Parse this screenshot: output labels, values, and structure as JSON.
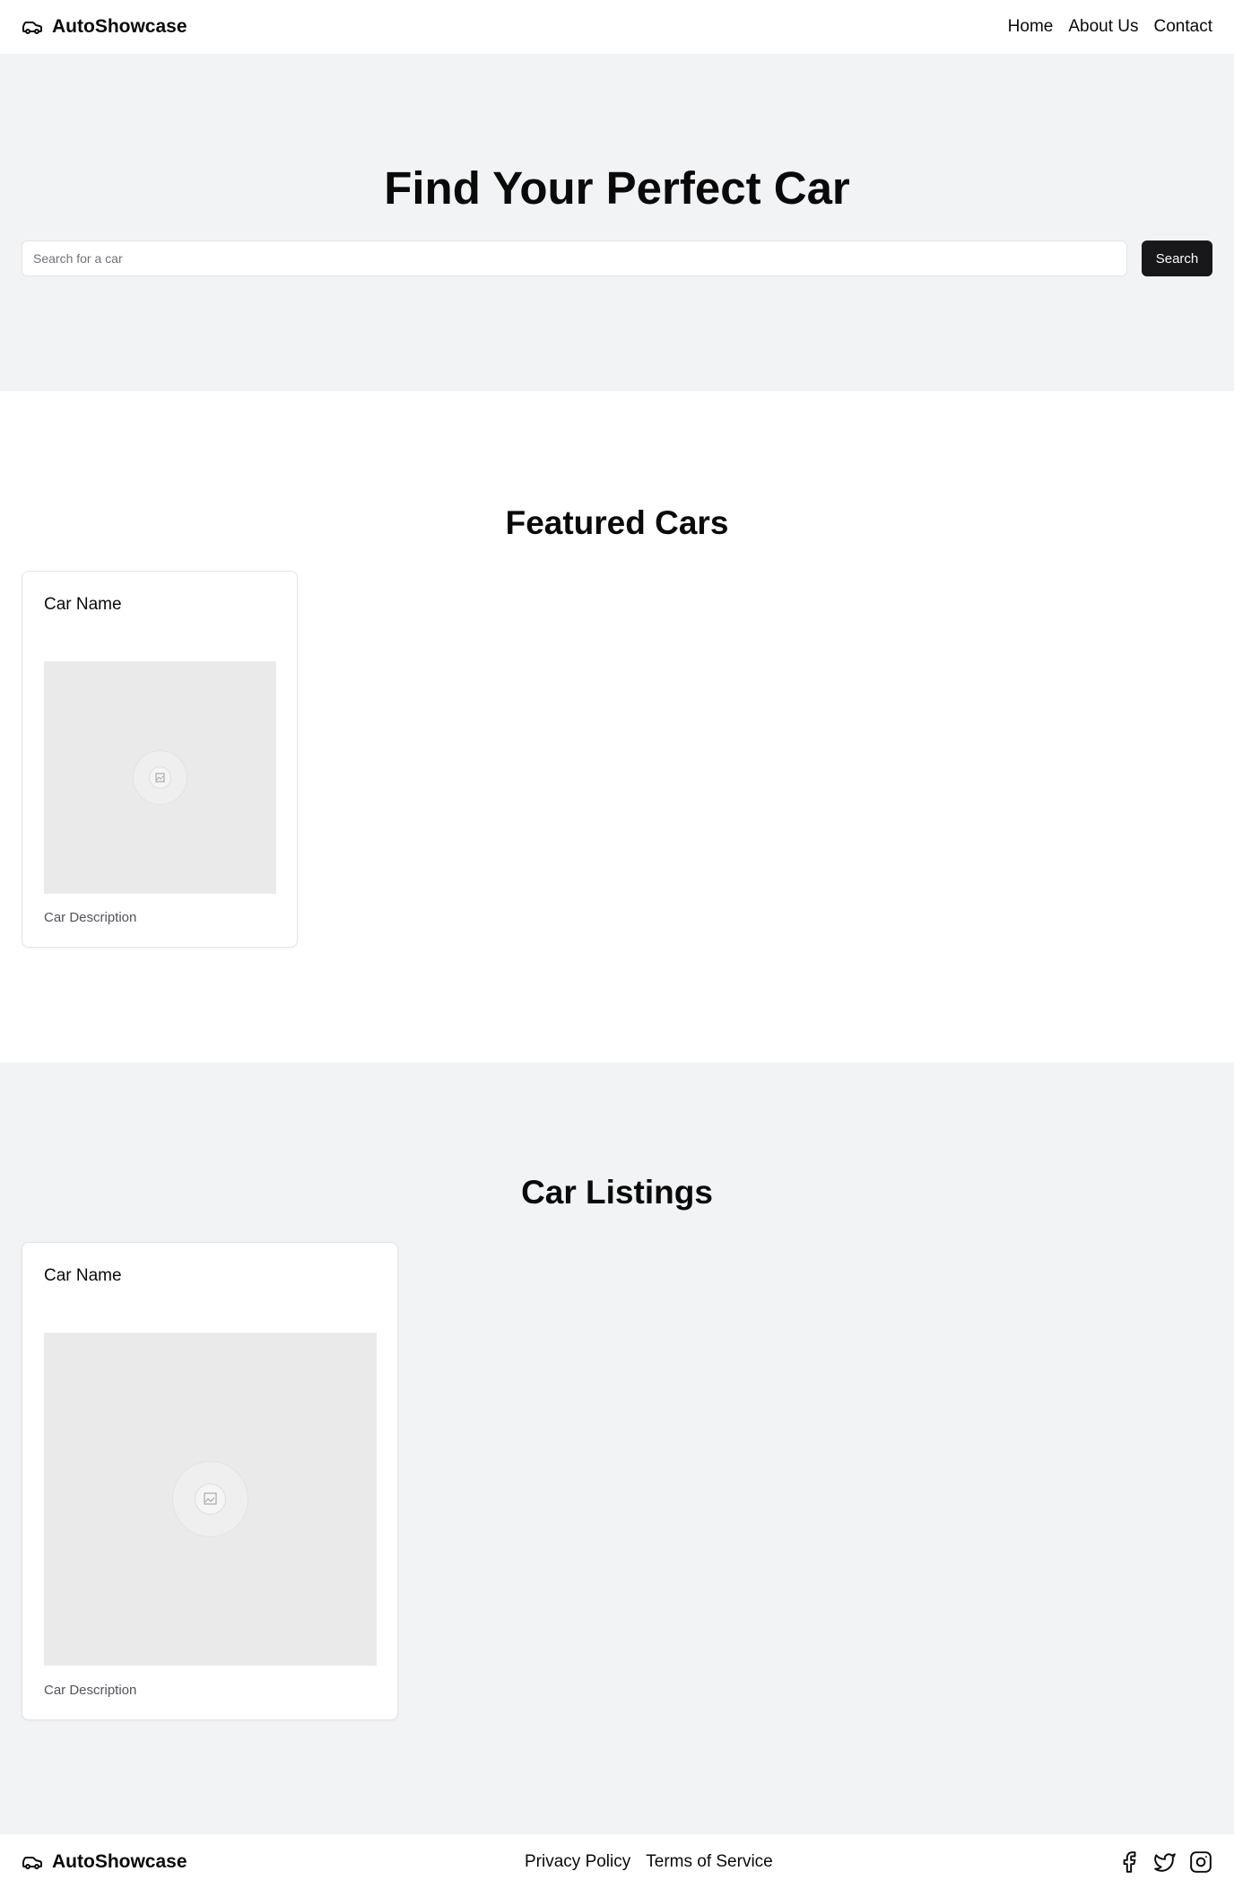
{
  "header": {
    "brand": "AutoShowcase",
    "nav": [
      "Home",
      "About Us",
      "Contact"
    ]
  },
  "hero": {
    "title": "Find Your Perfect Car",
    "search_placeholder": "Search for a car",
    "search_button": "Search"
  },
  "featured": {
    "title": "Featured Cars",
    "cards": [
      {
        "name": "Car Name",
        "description": "Car Description"
      }
    ]
  },
  "listings": {
    "title": "Car Listings",
    "cards": [
      {
        "name": "Car Name",
        "description": "Car Description"
      }
    ]
  },
  "footer": {
    "brand": "AutoShowcase",
    "links": [
      "Privacy Policy",
      "Terms of Service"
    ],
    "social_icons": [
      "facebook-icon",
      "twitter-icon",
      "instagram-icon"
    ]
  },
  "colors": {
    "primary_button": "#18181b",
    "section_bg": "#f2f3f5",
    "placeholder_image": "#eaeaea"
  }
}
